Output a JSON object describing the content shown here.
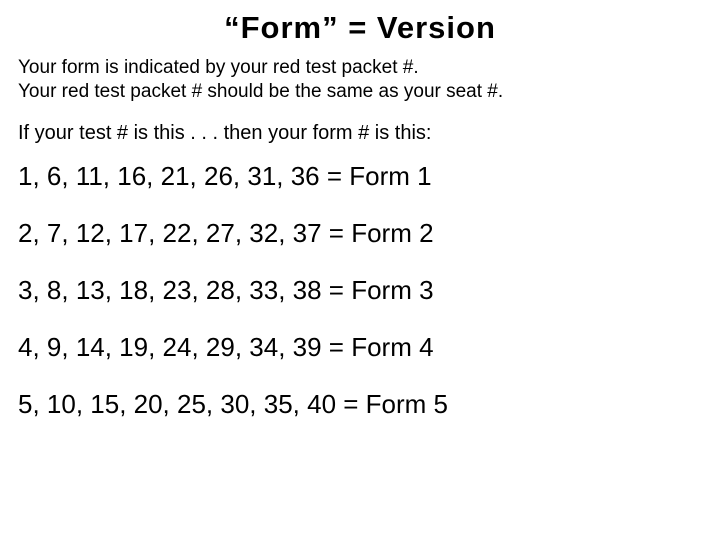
{
  "title": "“Form” = Version",
  "intro_line1": "Your form is indicated by your red test packet #.",
  "intro_line2": "Your red test packet # should be the same as your seat #.",
  "lead": "If your test # is this . . . then your form # is this:",
  "rows": [
    "1, 6, 11, 16, 21, 26, 31, 36 = Form 1",
    "2, 7, 12, 17, 22, 27, 32, 37 = Form 2",
    "3, 8, 13, 18, 23, 28, 33, 38 = Form 3",
    "4, 9, 14, 19, 24, 29, 34, 39 = Form 4",
    "5, 10, 15, 20, 25, 30, 35, 40 = Form 5"
  ]
}
